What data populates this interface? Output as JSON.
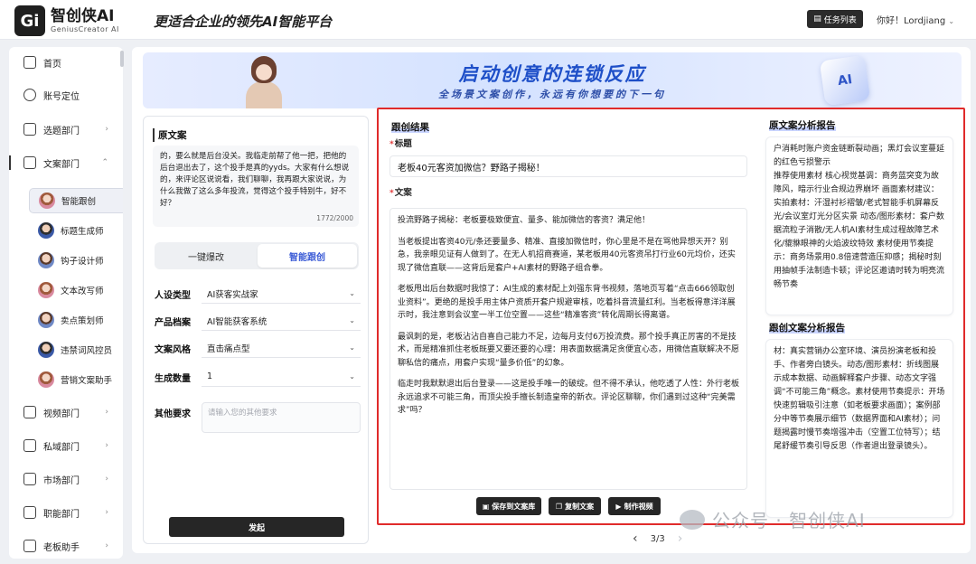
{
  "header": {
    "logo_mark": "Gi",
    "brand": "智创侠AI",
    "brand_sub": "GeniusCreator AI",
    "slogan": "更适合企业的领先AI智能平台",
    "task_button": "任务列表",
    "greeting": "你好！Lordjiang"
  },
  "sidebar": {
    "items_top": [
      {
        "label": "首页",
        "icon": "home-icon"
      },
      {
        "label": "账号定位",
        "icon": "target-icon"
      },
      {
        "label": "选题部门",
        "icon": "topic-icon"
      },
      {
        "label": "文案部门",
        "icon": "doc-icon"
      }
    ],
    "sub_items": [
      {
        "label": "智能跟创",
        "active": true
      },
      {
        "label": "标题生成师"
      },
      {
        "label": "钩子设计师"
      },
      {
        "label": "文本改写师"
      },
      {
        "label": "卖点策划师"
      },
      {
        "label": "违禁词风控员"
      },
      {
        "label": "营销文案助手"
      }
    ],
    "items_bottom": [
      {
        "label": "视频部门",
        "icon": "video-icon"
      },
      {
        "label": "私域部门",
        "icon": "private-icon"
      },
      {
        "label": "市场部门",
        "icon": "market-icon"
      },
      {
        "label": "职能部门",
        "icon": "function-icon"
      },
      {
        "label": "老板助手",
        "icon": "boss-icon"
      }
    ]
  },
  "banner": {
    "title": "启动创意的连锁反应",
    "subtitle": "全场景文案创作，永远有你想要的下一句",
    "cube_label": "AI"
  },
  "form": {
    "original_title": "原文案",
    "original_text": "的，要么就是后台没关。我临走前帮了他一把，把他的后台退出去了，这个投手是真的yyds。大家有什么想说的，来评论区说说看，我们聊聊，我再跟大家说说，为什么我做了这么多年投流，觉得这个投手特别牛，好不好？",
    "char_count": "1772/2000",
    "tab_quick": "一键爆改",
    "tab_smart": "智能跟创",
    "fields": [
      {
        "label": "人设类型",
        "value": "AI获客实战家"
      },
      {
        "label": "产品档案",
        "value": "AI智能获客系统"
      },
      {
        "label": "文案风格",
        "value": "直击痛点型"
      },
      {
        "label": "生成数量",
        "value": "1"
      }
    ],
    "other_label": "其他要求",
    "other_placeholder": "请输入您的其他要求",
    "generate_button": "发起"
  },
  "result": {
    "title": "跟创结果",
    "title_label": "标题",
    "title_value": "老板40元客资加微信？野路子揭秘！",
    "body_label": "文案",
    "paragraphs": [
      "投流野路子揭秘：老板要极致便宜、量多、能加微信的客资？满足他！",
      "当老板提出客资40元/条还要量多、精准、直接加微信时，你心里是不是在骂他异想天开？别急，我亲眼见证有人做到了。在无人机招商赛道，某老板用40元客资吊打行业60元均价，还实现了微信直联——这背后是套户+AI素材的野路子组合拳。",
      "老板甩出后台数据时我惊了：AI生成的素材配上刘强东背书视频，落地页写着“点击666领取创业资料”。更绝的是投手用主体户资质开套户规避审核，吃着抖音流量红利。当老板得意洋洋展示时，我注意到会议室一半工位空置——这些“精准客资”转化周期长得离谱。",
      "最讽刺的是，老板沾沾自喜自己能力不足，边每月支付6万投流费。那个投手真正厉害的不是技术，而是精准抓住老板既要又要还要的心理：用表面数据满足贪便宜心态，用微信直联解决不愿聊私信的痛点，用套户实现“量多价低”的幻象。",
      "临走时我默默退出后台登录——这是投手唯一的破绽。但不得不承认，他吃透了人性：外行老板永远追求不可能三角，而顶尖投手擅长制造皇帝的新衣。评论区聊聊，你们遇到过这种“完美需求”吗？"
    ],
    "buttons": [
      "保存到文案库",
      "复制文案",
      "制作视频"
    ],
    "report1_title": "原文案分析报告",
    "report1_text": "户消耗时账户资金链断裂动画；黑灯会议室蔓延的红色亏损警示\n推荐使用素材 核心视觉基调：商务蓝突变为故障风，暗示行业合规边界崩坏 画面素材建议： 实拍素材：汗湿衬衫褶皱/老式智能手机屏幕反光/会议室灯光分区实景 动态/图形素材：套户数据流粒子消散/无人机AI素材生成过程故障艺术化/貔貅眼神的火焰波纹特效 素材使用节奏提示：商务场景用0.8倍速营造压抑感；揭秘时刻用抽帧手法制造卡顿；评论区邀请时转为明亮流畅节奏",
    "report2_title": "跟创文案分析报告",
    "report2_text": "材：真实营销办公室环境、演员扮演老板和投手、作者旁白镜头。动态/图形素材：折线图展示成本数据、动画解释套户步骤、动态文字强调“不可能三角”概念。素材使用节奏提示：开场快速剪辑吸引注意（如老板要求画面）；案例部分中等节奏展示细节（数据界面和AI素材）；问题揭露时慢节奏增强冲击（空置工位特写）；结尾舒缓节奏引导反思（作者退出登录镜头）。"
  },
  "pager": {
    "text": "3/3"
  },
  "watermark": {
    "text": "公众号 · 智创侠AI"
  },
  "colors": {
    "accent": "#3b5bd6",
    "highlight_frame": "#e02b2b",
    "dark_button": "#262626"
  }
}
